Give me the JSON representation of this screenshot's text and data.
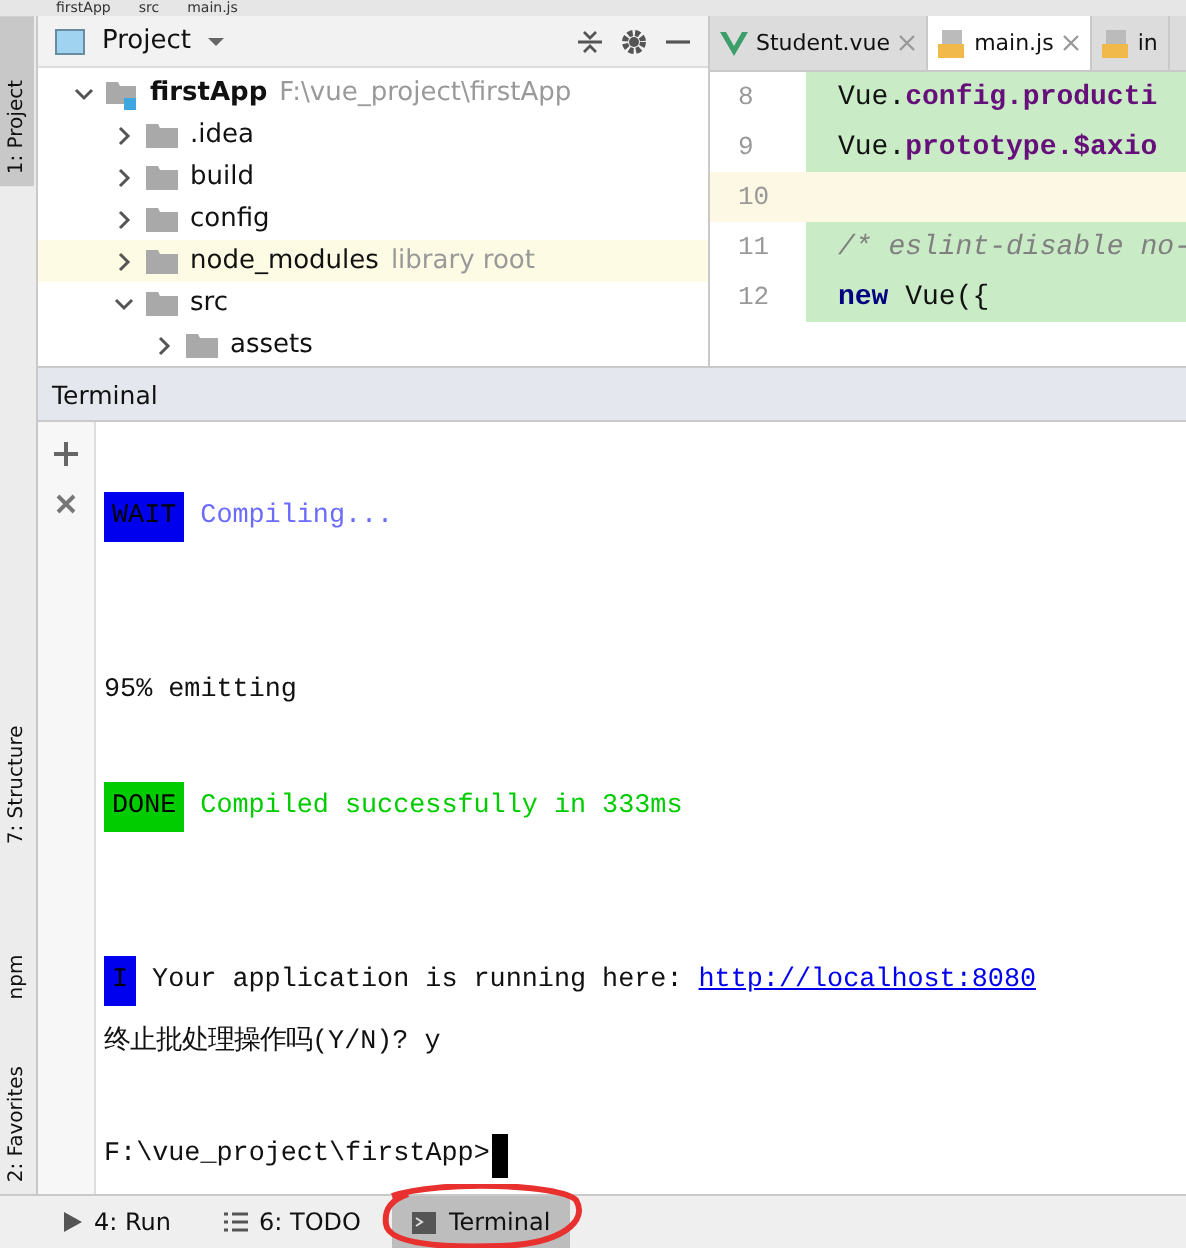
{
  "breadcrumbs": [
    "firstApp",
    "src",
    "main.js"
  ],
  "side_strip": [
    {
      "label": "1: Project",
      "selected": true,
      "kind": "project"
    },
    {
      "label": "7: Structure",
      "selected": false,
      "kind": "structure"
    },
    {
      "label": "npm",
      "selected": false,
      "kind": "npm"
    },
    {
      "label": "2: Favorites",
      "selected": false,
      "kind": "favorites"
    }
  ],
  "project_panel": {
    "title": "Project",
    "tree": [
      {
        "label": "firstApp",
        "note": "F:\\vue_project\\firstApp",
        "kind": "module",
        "expanded": true,
        "highlighted": false,
        "children": [
          {
            "label": ".idea",
            "kind": "folder",
            "expanded": false,
            "highlighted": false
          },
          {
            "label": "build",
            "kind": "folder",
            "expanded": false,
            "highlighted": false
          },
          {
            "label": "config",
            "kind": "folder",
            "expanded": false,
            "highlighted": false
          },
          {
            "label": "node_modules",
            "note": "library root",
            "kind": "folder",
            "expanded": false,
            "highlighted": true
          },
          {
            "label": "src",
            "kind": "folder",
            "expanded": true,
            "highlighted": false,
            "children": [
              {
                "label": "assets",
                "kind": "folder",
                "expanded": false,
                "highlighted": false
              }
            ]
          }
        ]
      }
    ]
  },
  "editor": {
    "tabs": [
      {
        "label": "Student.vue",
        "kind": "vue",
        "selected": false
      },
      {
        "label": "main.js",
        "kind": "js",
        "selected": true
      },
      {
        "label": "in",
        "kind": "js",
        "selected": false
      }
    ],
    "lines": [
      {
        "number": "8",
        "current": false,
        "changed": true,
        "segments": [
          {
            "text": "Vue.",
            "kind": "plain"
          },
          {
            "text": "config.producti",
            "kind": "field"
          }
        ]
      },
      {
        "number": "9",
        "current": false,
        "changed": true,
        "segments": [
          {
            "text": "Vue.",
            "kind": "plain"
          },
          {
            "text": "prototype.$axio",
            "kind": "field"
          }
        ]
      },
      {
        "number": "10",
        "current": true,
        "changed": false
      },
      {
        "number": "11",
        "current": false,
        "changed": true,
        "segments": [
          {
            "text": "/* eslint-disable no-",
            "kind": "comment"
          }
        ]
      },
      {
        "number": "12",
        "current": false,
        "changed": true,
        "segments": [
          {
            "text": "new",
            "kind": "keyword"
          },
          {
            "text": " Vue({",
            "kind": "plain"
          }
        ]
      }
    ]
  },
  "terminal": {
    "title": "Terminal",
    "lines": [
      {
        "kind": "blank"
      },
      {
        "kind": "wait",
        "badge": "WAIT",
        "color": "#0000ee",
        "text": "Compiling..."
      },
      {
        "kind": "blank"
      },
      {
        "kind": "blank"
      },
      {
        "kind": "plain",
        "text": " 95% emitting"
      },
      {
        "kind": "blank"
      },
      {
        "kind": "done",
        "badge": "DONE",
        "color": "#00cc00",
        "text": "Compiled successfully in 333ms"
      },
      {
        "kind": "blank"
      },
      {
        "kind": "blank"
      },
      {
        "kind": "info",
        "badge": "I",
        "color": "#0000ee",
        "text": "Your application is running here: ",
        "link": "http://localhost:8080"
      },
      {
        "kind": "plain",
        "text": "终止批处理操作吗(Y/N)? y"
      },
      {
        "kind": "blank"
      },
      {
        "kind": "prompt",
        "text": "F:\\vue_project\\firstApp>"
      }
    ]
  },
  "bottom_tabs": [
    {
      "label": "4: Run",
      "kind": "run",
      "selected": false
    },
    {
      "label": "6: TODO",
      "kind": "todo",
      "selected": false
    },
    {
      "label": "Terminal",
      "kind": "terminal",
      "selected": true,
      "circled": true
    }
  ]
}
